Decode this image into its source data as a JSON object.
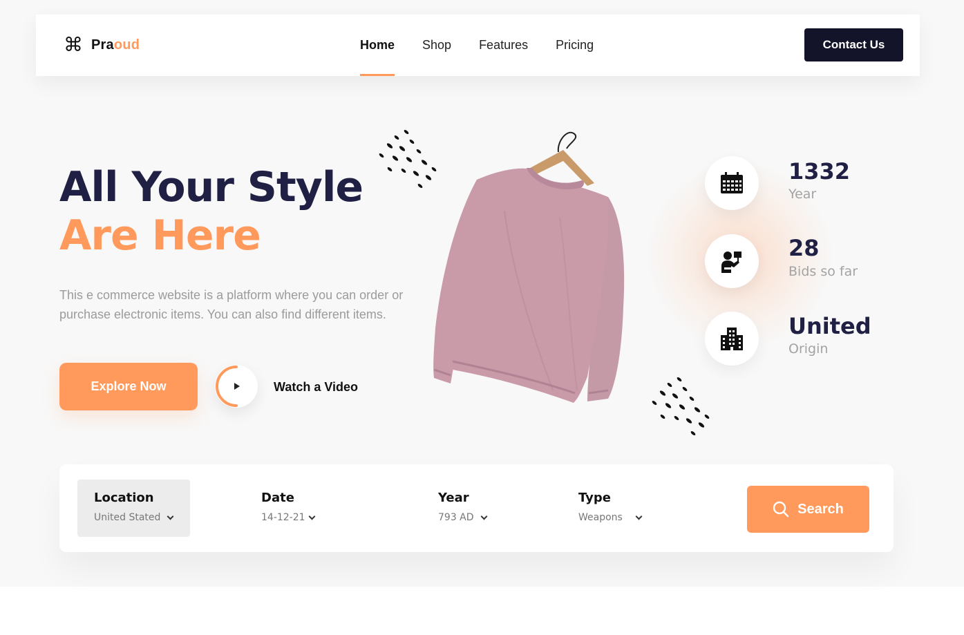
{
  "brand": {
    "name_prefix": "Pra",
    "name_accent": "oud",
    "logo_icon": "command-icon"
  },
  "nav": {
    "links": [
      {
        "label": "Home",
        "active": true
      },
      {
        "label": "Shop",
        "active": false
      },
      {
        "label": "Features",
        "active": false
      },
      {
        "label": "Pricing",
        "active": false
      }
    ],
    "contact_label": "Contact Us"
  },
  "hero": {
    "title_line1": "All Your Style",
    "title_line2": "Are Here",
    "description": "This e commerce website is a platform where you can order or purchase electronic items. You can also find different items.",
    "explore_label": "Explore Now",
    "watch_label": "Watch a Video"
  },
  "stats": [
    {
      "value": "1332",
      "label": "Year",
      "icon": "calendar-icon"
    },
    {
      "value": "28",
      "label": "Bids so far",
      "icon": "auction-icon"
    },
    {
      "value": "United",
      "label": "Origin",
      "icon": "building-icon"
    }
  ],
  "filters": {
    "location": {
      "title": "Location",
      "value": "United Stated"
    },
    "date": {
      "title": "Date",
      "value": "14-12-21"
    },
    "year": {
      "title": "Year",
      "value": "793 AD"
    },
    "type": {
      "title": "Type",
      "value": "Weapons"
    },
    "search_label": "Search"
  },
  "colors": {
    "accent": "#ff9a5c",
    "dark": "#13132a",
    "heading": "#1f2044",
    "product": "#c99aa8"
  }
}
